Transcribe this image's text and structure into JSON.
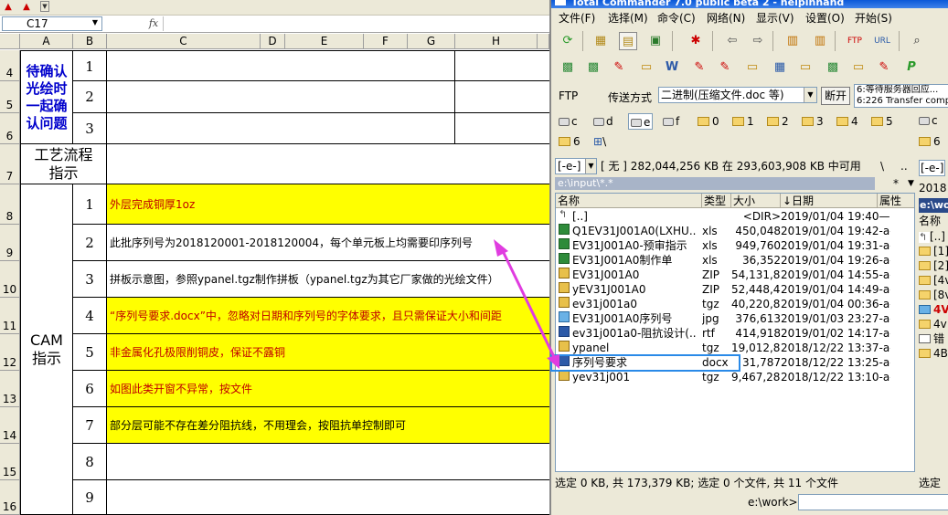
{
  "excel": {
    "name_box": "C17",
    "fx_label": "fx",
    "columns": [
      "A",
      "B",
      "C",
      "D",
      "E",
      "F",
      "G",
      "H"
    ],
    "rows": [
      {
        "num": "4",
        "b": "1",
        "c": ""
      },
      {
        "num": "5",
        "b": "2",
        "c": ""
      },
      {
        "num": "6",
        "b": "3",
        "c": ""
      },
      {
        "num": "7",
        "b": "",
        "c": ""
      },
      {
        "num": "8",
        "b": "1",
        "c": "外层完成铜厚1oz"
      },
      {
        "num": "9",
        "b": "2",
        "c": "此批序列号为2018120001-2018120004，每个单元板上均需要印序列号"
      },
      {
        "num": "10",
        "b": "3",
        "c": "拼板示意图，参照ypanel.tgz制作拼板（ypanel.tgz为其它厂家做的光绘文件）"
      },
      {
        "num": "11",
        "b": "4",
        "c": "“序列号要求.docx”中，忽略对日期和序列号的字体要求，且只需保证大小和间距"
      },
      {
        "num": "12",
        "b": "5",
        "c": "非金属化孔极限削铜皮，保证不露铜"
      },
      {
        "num": "13",
        "b": "6",
        "c": "如图此类开窗不异常，按文件"
      },
      {
        "num": "14",
        "b": "7",
        "c": "部分层可能不存在差分阻抗线，不用理会，按阻抗单控制即可"
      },
      {
        "num": "15",
        "b": "8",
        "c": ""
      },
      {
        "num": "16",
        "b": "9",
        "c": ""
      }
    ],
    "group_confirm": "待确认光绘时一起确认问题",
    "group_process": "工艺流程指示",
    "group_cam": "CAM指示"
  },
  "tc": {
    "title": "Total Commander 7.0 public beta 2 - helpinhand",
    "menu": [
      "文件(F)",
      "选择(M)",
      "命令(C)",
      "网络(N)",
      "显示(V)",
      "设置(O)",
      "开始(S)"
    ],
    "ftp": {
      "label": "FTP",
      "mode_label": "传送方式",
      "mode_value": "二进制(压缩文件.doc 等)",
      "disconnect": "断开",
      "log_line1": "6:等待服务器回应...",
      "log_line2": "6:226 Transfer comple"
    },
    "drives_row1": [
      "c",
      "d",
      "e",
      "f",
      "0",
      "1",
      "2",
      "3",
      "4",
      "5"
    ],
    "drives_row2": [
      "6",
      "\\"
    ],
    "drive_select": "[-e-]",
    "free_space": "[ 无 ]  282,044,256 KB 在 293,603,908 KB 中可用",
    "path_btn_root": "\\",
    "path_btn_up": "..",
    "path": "e:\\input\\*.*",
    "path_star": "*",
    "path_dd": "▼",
    "headers": {
      "name": "名称",
      "type": "类型",
      "size": "大小",
      "date": "↓日期",
      "attr": "属性"
    },
    "files": [
      {
        "name": "[..]",
        "type": "",
        "size": "<DIR>",
        "date": "2019/01/04 19:40—",
        "icon": "up"
      },
      {
        "name": "Q1EV31J001A0(LXHU..",
        "type": "xls",
        "size": "450,048",
        "date": "2019/01/04 19:42-a-",
        "icon": "excel"
      },
      {
        "name": "EV31J001A0-预审指示",
        "type": "xls",
        "size": "949,760",
        "date": "2019/01/04 19:31-a-",
        "icon": "excel"
      },
      {
        "name": "EV31J001A0制作单",
        "type": "xls",
        "size": "36,352",
        "date": "2019/01/04 19:26-a-",
        "icon": "excel"
      },
      {
        "name": "EV31J001A0",
        "type": "ZIP",
        "size": "54,131,837",
        "date": "2019/01/04 14:55-a-",
        "icon": "pkg"
      },
      {
        "name": "yEV31J001A0",
        "type": "ZIP",
        "size": "52,448,422",
        "date": "2019/01/04 14:49-a-",
        "icon": "pkg"
      },
      {
        "name": "ev31j001a0",
        "type": "tgz",
        "size": "40,220,830",
        "date": "2019/01/04 00:36-a-",
        "icon": "pkg"
      },
      {
        "name": "EV31J001A0序列号",
        "type": "jpg",
        "size": "376,613",
        "date": "2019/01/03 23:27-a-",
        "icon": "img"
      },
      {
        "name": "ev31j001a0-阻抗设计(..",
        "type": "rtf",
        "size": "414,918",
        "date": "2019/01/02 14:17-a-",
        "icon": "word"
      },
      {
        "name": "ypanel",
        "type": "tgz",
        "size": "19,012,813",
        "date": "2018/12/22 13:37-a-",
        "icon": "pkg"
      },
      {
        "name": "序列号要求",
        "type": "docx",
        "size": "31,787",
        "date": "2018/12/22 13:25-a-",
        "icon": "word"
      },
      {
        "name": "yev31j001",
        "type": "tgz",
        "size": "9,467,287",
        "date": "2018/12/22 13:10-a-",
        "icon": "pkg"
      }
    ],
    "status": "选定 0 KB, 共 173,379 KB; 选定 0 个文件, 共 11 个文件",
    "cmd_label": "e:\\work>",
    "right_panel": {
      "drive": "[-e-]",
      "header_date": "2018",
      "path": "e:\\wor",
      "name_hdr": "名称",
      "items": [
        "[..]",
        "[1]",
        "[2]",
        "[4v",
        "[8v",
        "4V",
        "4v",
        "错",
        "4B"
      ],
      "status": "选定",
      "drives_row1": [
        "c"
      ],
      "drives_row2": [
        "6"
      ]
    }
  },
  "colors": {
    "yellow": "#ffff00",
    "red_text": "#c00000",
    "blue_text": "#0000cc",
    "highlight": "#2a8ae8",
    "arrow": "#e03ce0"
  }
}
